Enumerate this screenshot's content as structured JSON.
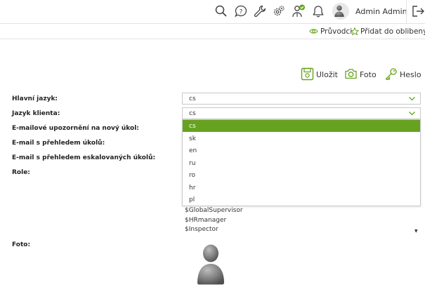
{
  "topbar": {
    "icons": [
      "search-icon",
      "help-icon",
      "wrench-icon",
      "settings-icon",
      "approver-icon",
      "bell-icon",
      "avatar",
      "logout-icon"
    ],
    "user_name": "Admin Admin"
  },
  "subbar": {
    "guides_label": "Průvodci",
    "favorites_label": "Přidat do oblibených"
  },
  "actions": {
    "save_label": "Uložit",
    "photo_label": "Foto",
    "password_label": "Heslo"
  },
  "form": {
    "main_language_label": "Hlavní jazyk:",
    "main_language_value": "cs",
    "client_language_label": "Jazyk klienta:",
    "client_language_value": "cs",
    "new_task_email_label": "E-mailové upozornění na nový úkol:",
    "task_overview_email_label": "E-mail s přehledem úkolů:",
    "escalated_email_label": "E-mail s přehledem eskalovaných úkolů:",
    "role_label": "Role:",
    "photo_label": "Foto:"
  },
  "language_options": [
    "cs",
    "sk",
    "en",
    "ru",
    "ro",
    "hr",
    "pl"
  ],
  "selected_language": "cs",
  "roles": [
    "$GlobalSupervisor",
    "$HRmanager",
    "$Inspector"
  ],
  "colors": {
    "accent_green": "#66a21f",
    "border": "#c9c9c9"
  }
}
